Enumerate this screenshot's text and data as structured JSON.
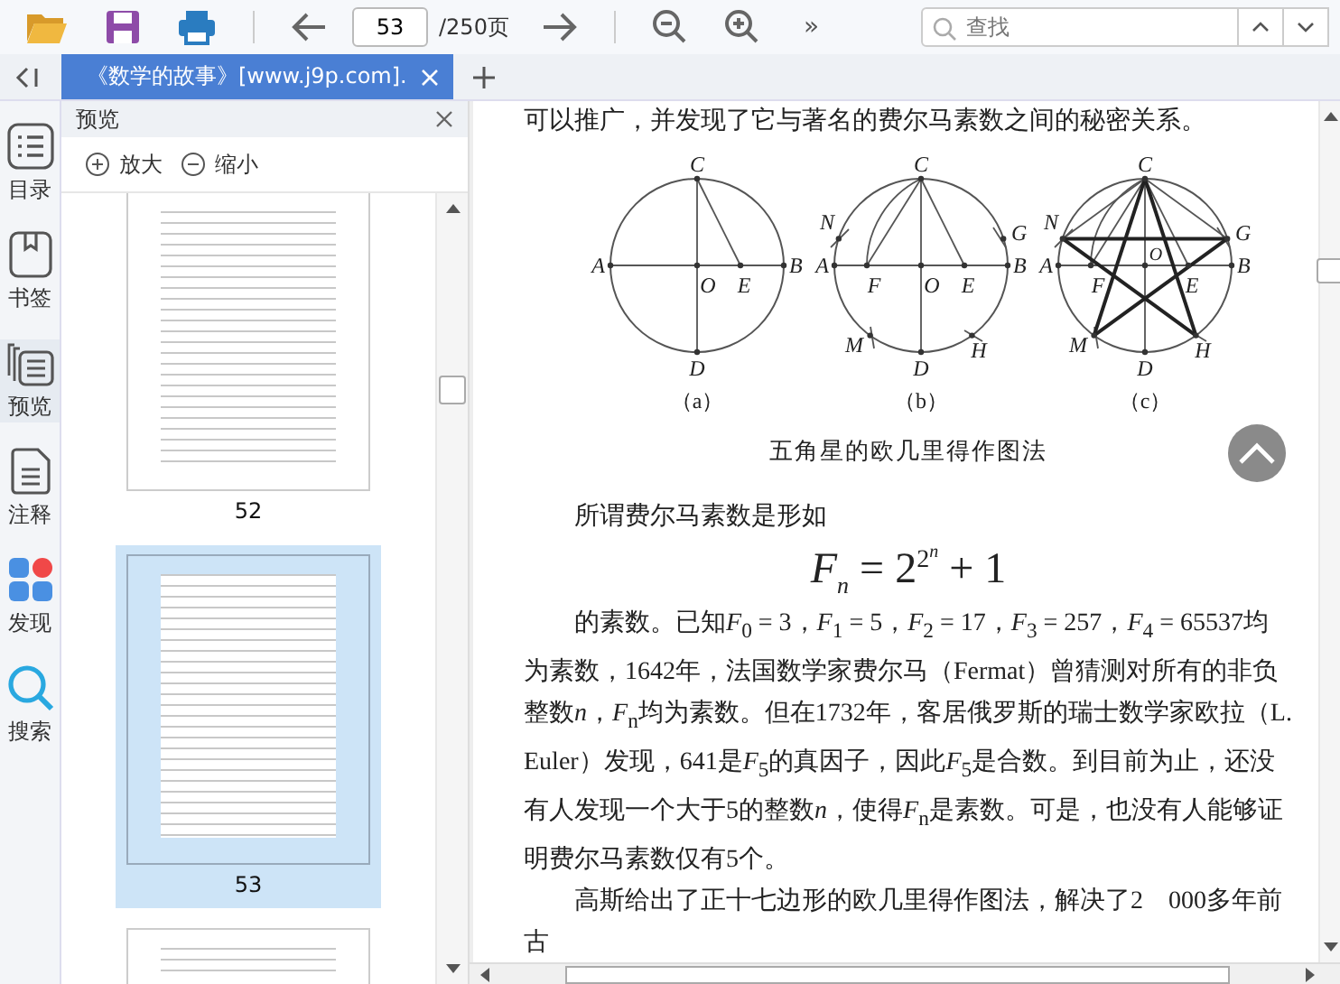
{
  "toolbar": {
    "page_input": "53",
    "page_total": "/250页",
    "overflow": "»",
    "search": {
      "placeholder": "查找"
    }
  },
  "tabs": [
    {
      "title": "《数学的故事》[www.j9p.com].",
      "selected": true
    }
  ],
  "rail": [
    {
      "label": "目录",
      "kind": "toc",
      "selected": false
    },
    {
      "label": "书签",
      "kind": "bookmark",
      "selected": false
    },
    {
      "label": "预览",
      "kind": "preview",
      "selected": true
    },
    {
      "label": "注释",
      "kind": "note",
      "selected": false
    },
    {
      "label": "发现",
      "kind": "discover",
      "selected": false
    },
    {
      "label": "搜索",
      "kind": "search",
      "selected": false
    }
  ],
  "preview": {
    "title": "预览",
    "zoom_in": "放大",
    "zoom_out": "缩小",
    "pages": [
      {
        "number": "52",
        "selected": false,
        "kind": "first"
      },
      {
        "number": "53",
        "selected": true,
        "kind": "full"
      },
      {
        "selected": false,
        "kind": "last"
      }
    ]
  },
  "document": {
    "lead": "可以推广，并发现了它与著名的费尔马素数之间的秘密关系。",
    "figures": [
      {
        "kind": "axes",
        "caption": "（a）",
        "labels": [
          "C",
          "A",
          "O",
          "E",
          "B",
          "D"
        ]
      },
      {
        "kind": "arcs",
        "caption": "（b）",
        "labels": [
          "N",
          "C",
          "G",
          "A",
          "F",
          "O",
          "E",
          "B",
          "M",
          "H",
          "D"
        ]
      },
      {
        "kind": "star",
        "caption": "（c）",
        "labels": [
          "N",
          "C",
          "G",
          "A",
          "F",
          "O",
          "E",
          "B",
          "M",
          "H",
          "D"
        ]
      }
    ],
    "figure_title": "五角星的欧几里得作图法",
    "intro": "所谓费尔马素数是形如",
    "formula": {
      "symbol": "F",
      "subscript": "n",
      "middle": "= 2",
      "exponent": "2",
      "exponent_power": "n",
      "tail": "+ 1"
    },
    "paragraphs": [
      [
        "的素数。已知",
        "*F*$_{0}$ = 3，*F*$_{1}$ = 5，*F*$_{2}$ = 17，*F*$_{3}$ = 257，*F*$_{4}$ = 65537均为素数，1642年，法国数学家费尔马（Fermat）曾猜测对所有的非负整数",
        "*n*，*F*$_{n}$均为素数。但在1732年，客居俄罗斯的瑞士数学家欧拉（L. Euler）发现，641是",
        "*F*$_{5}$的真因子，因此",
        "*F*$_{5}$是合数。到目前为止，还没有人发现一个大于5的整数",
        "*n*，使得",
        "*F*$_{n}$是素数。可是，也没有人能够证明费尔马素数仅有5个。"
      ],
      [
        "高斯给出了正十七边形的欧几里得作图法，解决了2　000多年前古"
      ]
    ]
  }
}
